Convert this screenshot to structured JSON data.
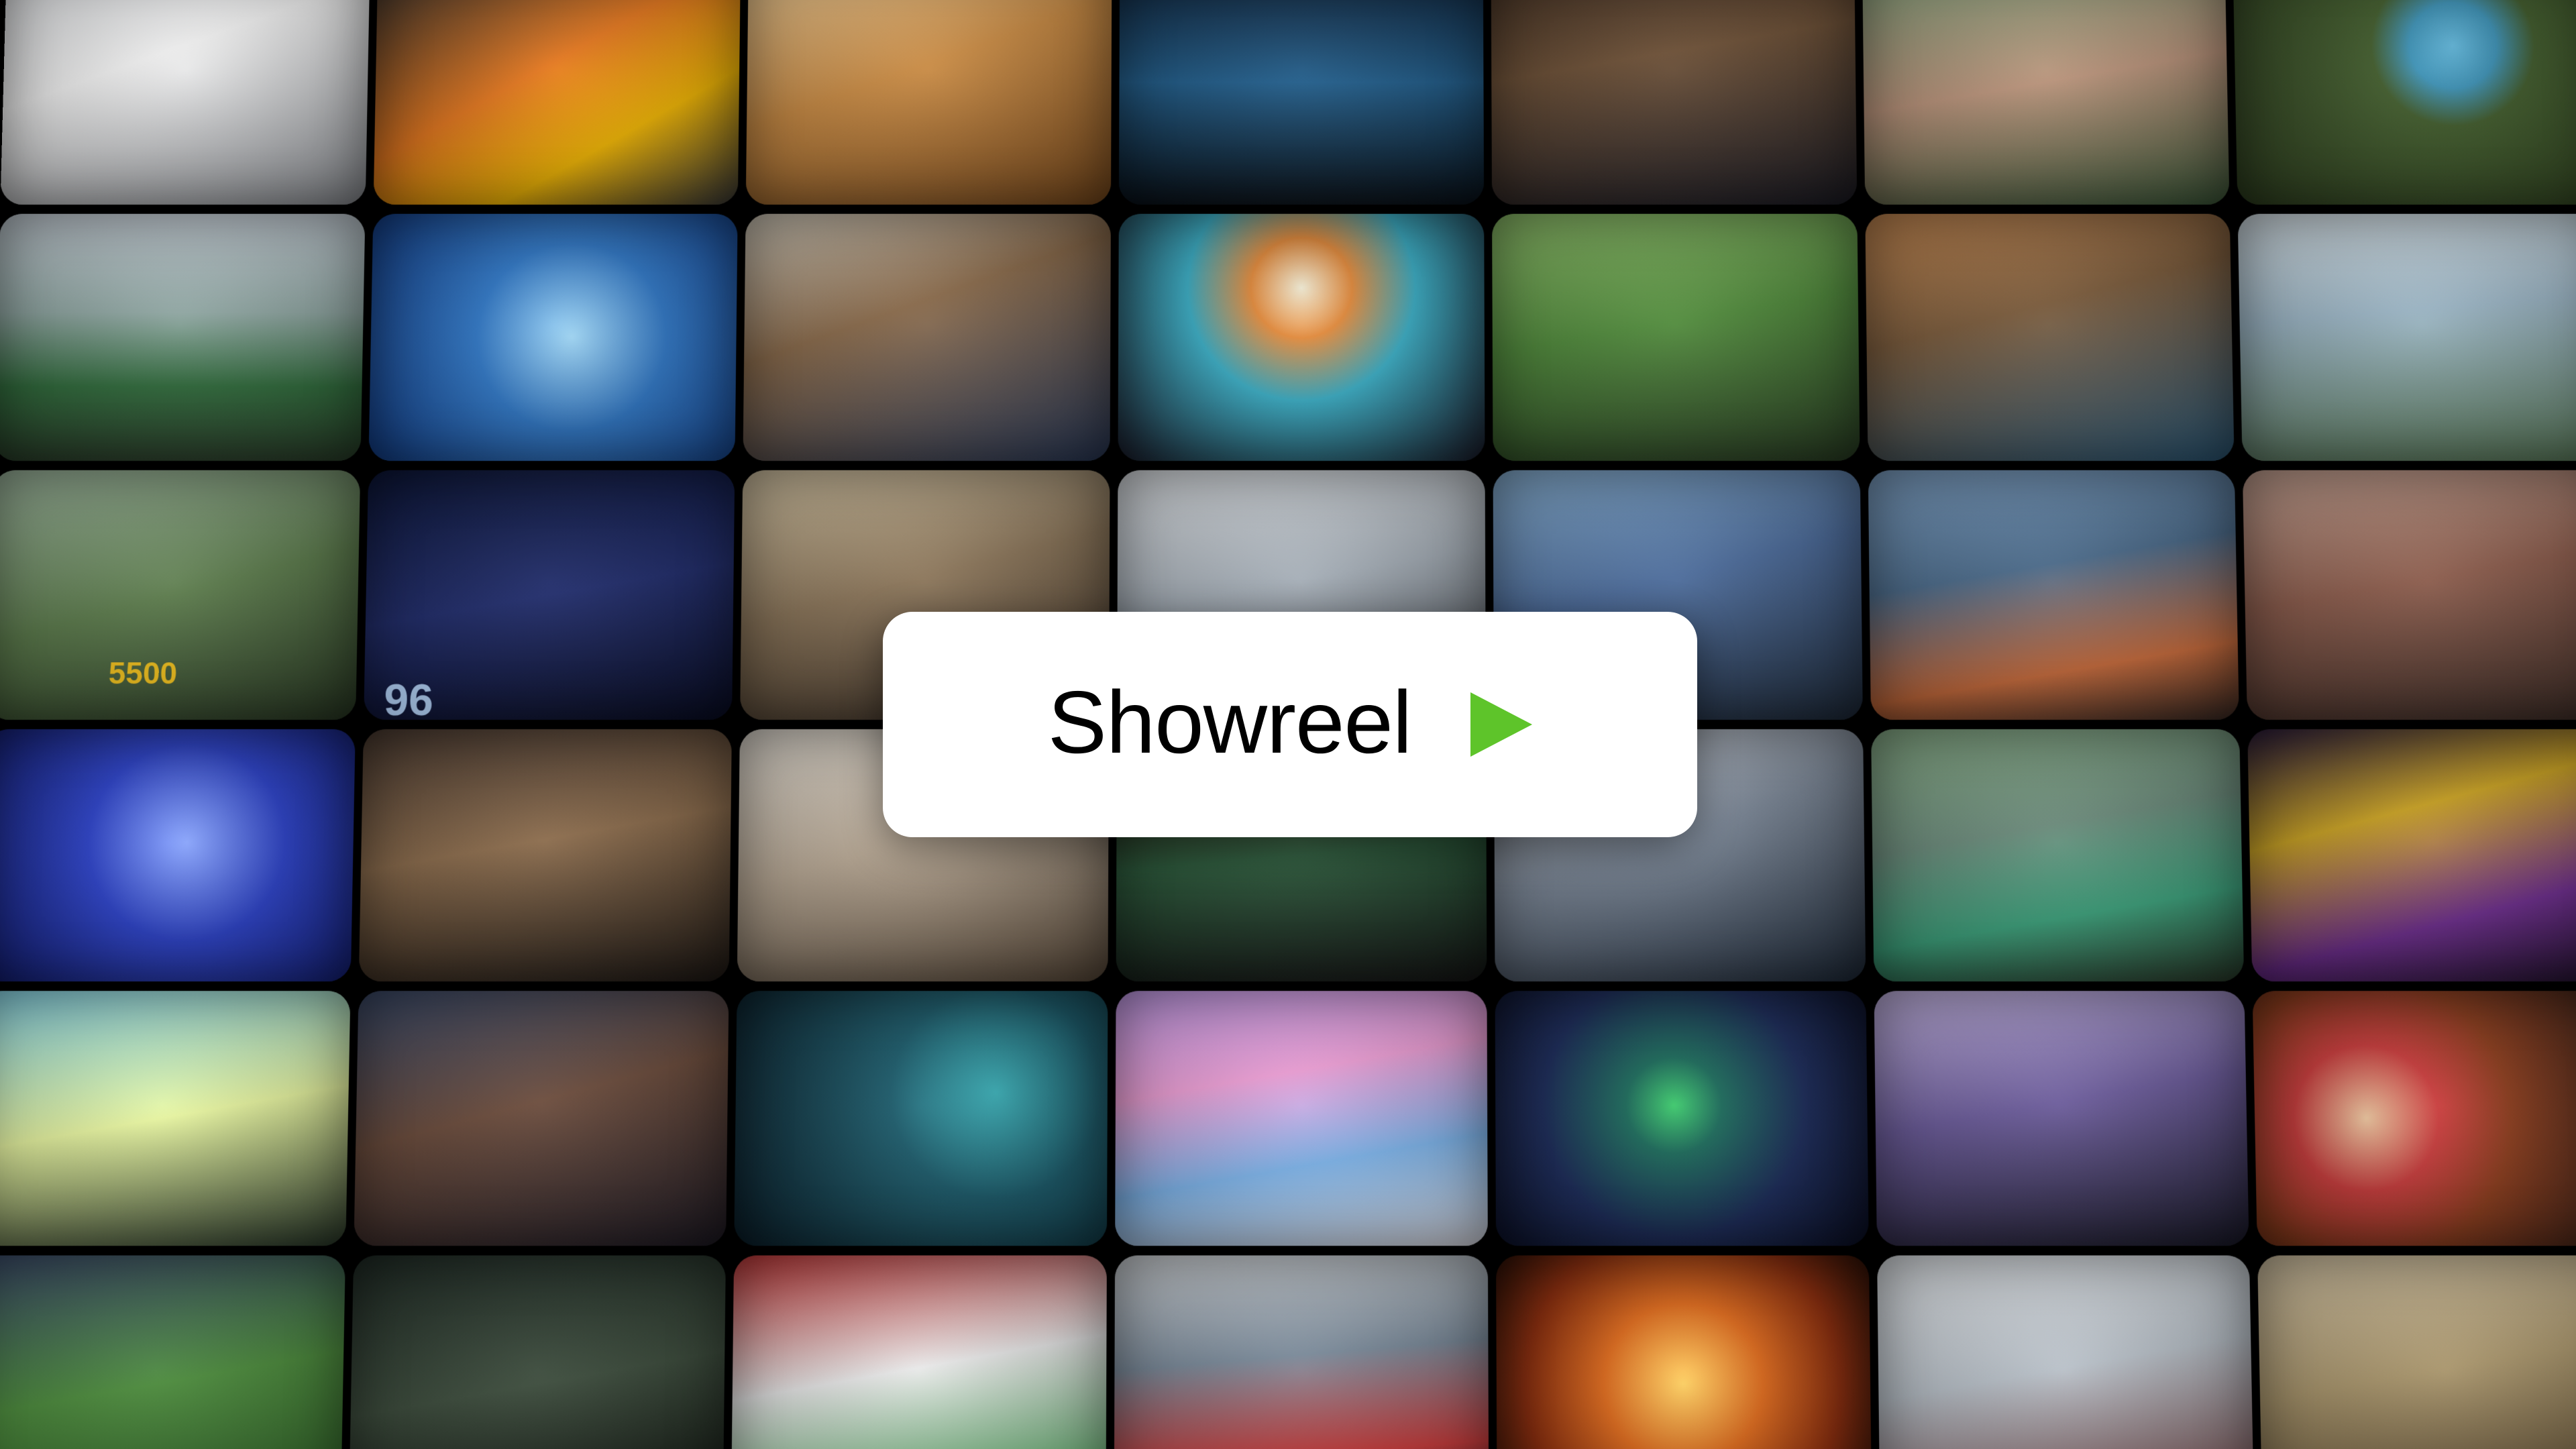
{
  "showreel": {
    "label": "Showreel",
    "play_icon": "play-icon",
    "accent_color": "#5ec42a",
    "card_background": "#ffffff",
    "text_color": "#000000"
  },
  "grid": {
    "rows": 6,
    "columns": 7,
    "tiles": [
      {
        "scene": "photographer-studio-tile",
        "bg": "linear-gradient(160deg,#d9dbde 0%,#f2f2f2 40%,#8e9196 100%)"
      },
      {
        "scene": "chess-figures-tile",
        "bg": "linear-gradient(150deg,#2a2a2a 0%,#e4761c 45%,#f0b400 70%,#3a3a3a 100%)"
      },
      {
        "scene": "curtain-silhouette-tile",
        "bg": "linear-gradient(160deg,#f3d29c 0%,#c98a42 45%,#7a4a1c 100%)"
      },
      {
        "scene": "stage-performer-tile",
        "bg": "linear-gradient(180deg,#0a1a2e 0%,#1f5c8a 50%,#081018 100%)"
      },
      {
        "scene": "bar-conversation-tile",
        "bg": "linear-gradient(170deg,#3b2a1e 0%,#6b4e34 40%,#1b1b24 100%)"
      },
      {
        "scene": "girl-portrait-tile",
        "bg": "linear-gradient(170deg,#7fa07a 0%,#b99279 50%,#3d5a3a 100%)"
      },
      {
        "scene": "aerial-pond-tile",
        "bg": "radial-gradient(circle at 60% 35%,#5fb4d8 0%,#3a8fb3 16%,#3f5a2a 30%,#2d3d1e 100%)"
      },
      {
        "scene": "dog-playground-tile",
        "bg": "linear-gradient(180deg,#c9d3db 0%,#8fa6a2 40%,#2e6a3a 70%,#2a3f2a 100%)"
      },
      {
        "scene": "swimmer-pool-tile",
        "bg": "radial-gradient(circle at 55% 50%,#9fd6f5 0%,#2f78c8 40%,#123f8c 100%)"
      },
      {
        "scene": "robot-lab-tile",
        "bg": "linear-gradient(160deg,#d8d0c0 0%,#8a6a4a 40%,#2a3a5a 100%)"
      },
      {
        "scene": "neon-portrait-tile",
        "bg": "radial-gradient(circle at 50% 30%,#f6f0d8 0%,#e48a3a 20%,#3ab0c8 45%,#1b1b2a 100%)"
      },
      {
        "scene": "officer-park-tile",
        "bg": "linear-gradient(170deg,#8fc06a 0%,#4f8a3a 45%,#2a3f24 100%)"
      },
      {
        "scene": "sofa-living-room-tile",
        "bg": "linear-gradient(165deg,#c88a52 0%,#7a5a3a 40%,#2c5a7a 100%)"
      },
      {
        "scene": "friends-walking-tile",
        "bg": "linear-gradient(175deg,#d9e4ea 0%,#9ab4c4 40%,#5a7a5a 100%)"
      },
      {
        "scene": "coins-game-tile",
        "bg": "linear-gradient(165deg,#9fb8a0 0%,#5a7a4a 50%,#2a3a24 100%)",
        "text": "5500",
        "text_color": "#f3c21b",
        "text_size": 46,
        "text_left": 180,
        "text_top": 282
      },
      {
        "scene": "data-screens-tile",
        "bg": "linear-gradient(170deg,#0a1438 0%,#1e2a6a 50%,#080c24 100%)",
        "text": "96",
        "text_color": "#b8d8ff",
        "text_size": 66,
        "text_left": 30,
        "text_top": 312
      },
      {
        "scene": "office-desk-tile",
        "bg": "linear-gradient(165deg,#d9c9a8 0%,#8a7458 45%,#3a2e24 100%)"
      },
      {
        "scene": "stadium-roof-tile",
        "bg": "linear-gradient(170deg,#e4e8ec 0%,#a4adb6 45%,#3a3e44 100%)"
      },
      {
        "scene": "hockey-kid-tile",
        "bg": "linear-gradient(165deg,#8ab4d8 0%,#4a6a9a 45%,#1e2a3a 100%)"
      },
      {
        "scene": "meditation-sofa-tile",
        "bg": "linear-gradient(170deg,#7fa3c8 0%,#4a6a8a 40%,#c86a3a 75%,#3a2a24 100%)"
      },
      {
        "scene": "family-street-tile",
        "bg": "linear-gradient(170deg,#c8a494 0%,#8a5a4a 45%,#3a2a24 100%)"
      },
      {
        "scene": "fortune-teller-tile",
        "bg": "radial-gradient(circle at 55% 45%,#8aa6ff 0%,#2a40c8 40%,#101a6a 100%)"
      },
      {
        "scene": "candles-ritual-tile",
        "bg": "linear-gradient(170deg,#4a3a30 0%,#8a6a4a 45%,#1e1814 100%)"
      },
      {
        "scene": "laptop-mug-tile",
        "bg": "linear-gradient(165deg,#e8e2d8 0%,#b8a894 45%,#5a4a3a 100%)"
      },
      {
        "scene": "dinner-table-tile",
        "bg": "linear-gradient(175deg,#4a3a24 0%,#2a5a3a 50%,#141414 100%)"
      },
      {
        "scene": "bearded-man-tile",
        "bg": "linear-gradient(160deg,#dadfe6 0%,#7a8696 45%,#1e2a3a 100%)"
      },
      {
        "scene": "vintage-car-tile",
        "bg": "linear-gradient(170deg,#8ab08a 0%,#6a8a7a 40%,#3aa07a 70%,#2a3a2a 100%)"
      },
      {
        "scene": "neon-text-face-tile",
        "bg": "linear-gradient(165deg,#2a1a3a 0%,#c8a020 35%,#6a2a8a 70%,#1a0e24 100%)"
      },
      {
        "scene": "tv-show-set-tile",
        "bg": "linear-gradient(170deg,#8adcf0 0%,#e8f6a0 50%,#2a3a2a 100%)"
      },
      {
        "scene": "birthday-cake-tile",
        "bg": "linear-gradient(165deg,#3a4a6a 0%,#6a4a3a 45%,#1e1a24 100%)"
      },
      {
        "scene": "underwater-wave-tile",
        "bg": "radial-gradient(circle at 70% 40%,#3ab0b8 0%,#1a5a6a 35%,#0a1e2a 100%)"
      },
      {
        "scene": "stereotypes-show-tile",
        "bg": "linear-gradient(170deg,#c8a0f0 0%,#f0a0d8 35%,#80b8f0 65%,#e8e8f0 100%)"
      },
      {
        "scene": "game-portal-tile",
        "bg": "radial-gradient(circle at 48% 45%,#3ac86a 0%,#1a6a5a 20%,#1a2a5a 55%,#0a0e24 100%)"
      },
      {
        "scene": "film-crew-tile",
        "bg": "linear-gradient(170deg,#c8b8e8 0%,#6a5a9a 45%,#1a1a2a 100%)"
      },
      {
        "scene": "wheel-of-fortune-tile",
        "bg": "radial-gradient(circle at 30% 50%,#f0c8a0 0%,#c83a3a 25%,#8a3a1a 50%,#2a1a14 100%)"
      },
      {
        "scene": "grass-closeup-tile",
        "bg": "linear-gradient(170deg,#3a4a6a 0%,#4a8a3a 50%,#2a5a24 100%)"
      },
      {
        "scene": "dark-hallway-tile",
        "bg": "linear-gradient(170deg,#1e2a24 0%,#3a4a3a 50%,#0a0e0a 100%)"
      },
      {
        "scene": "football-presenter-tile",
        "bg": "linear-gradient(170deg,#c83a3a 0%,#e8e8e8 45%,#3aa04a 100%)"
      },
      {
        "scene": "stadium-referee-tile",
        "bg": "linear-gradient(175deg,#d8dce0 0%,#7a8a9a 40%,#c83a3a 75%,#2a1a1a 100%)"
      },
      {
        "scene": "circuit-glow-tile",
        "bg": "radial-gradient(circle at 50% 50%,#ffd060 0%,#e06a1a 35%,#8a2a0a 70%,#2a0e04 100%)"
      },
      {
        "scene": "office-fall-tile",
        "bg": "linear-gradient(170deg,#e8ecf0 0%,#b8c0c8 45%,#6a3a3a 100%)"
      },
      {
        "scene": "elevator-man-tile",
        "bg": "linear-gradient(170deg,#d8c8a8 0%,#a8946a 45%,#4a3a24 100%)"
      }
    ]
  }
}
